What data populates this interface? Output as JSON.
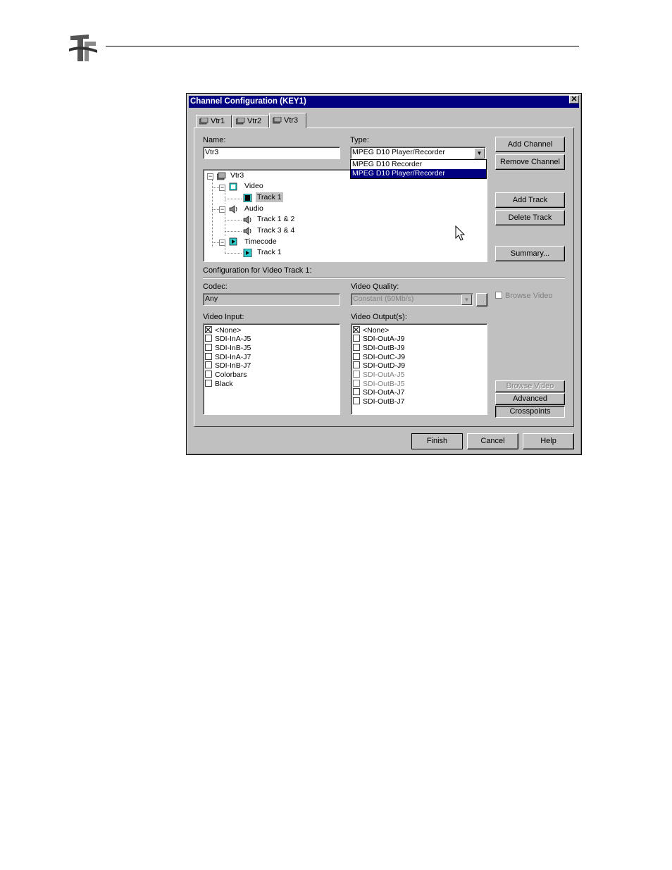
{
  "dialog": {
    "title": "Channel Configuration (KEY1)",
    "close_glyph": "✕"
  },
  "tabs": [
    {
      "label": "Vtr1",
      "icon": "vtr-icon"
    },
    {
      "label": "Vtr2",
      "icon": "vtr-icon"
    },
    {
      "label": "Vtr3",
      "icon": "vtr-icon",
      "active": true
    }
  ],
  "name": {
    "label": "Name:",
    "value": "Vtr3"
  },
  "type": {
    "label": "Type:",
    "value": "MPEG D10 Player/Recorder",
    "options": [
      "MPEG D10 Recorder",
      "MPEG D10 Player/Recorder"
    ],
    "selected_option": "MPEG D10 Player/Recorder"
  },
  "tree": {
    "root": "Vtr3",
    "video": "Video",
    "video_track": "Track 1",
    "audio": "Audio",
    "audio_tracks": [
      "Track 1 & 2",
      "Track 3 & 4"
    ],
    "timecode": "Timecode",
    "timecode_track": "Track 1"
  },
  "side_buttons": {
    "add_channel": "Add Channel",
    "remove_channel": "Remove Channel",
    "add_track": "Add Track",
    "delete_track": "Delete Track",
    "summary": "Summary..."
  },
  "config_heading": "Configuration for Video Track 1:",
  "codec": {
    "label": "Codec:",
    "value": "Any"
  },
  "video_quality": {
    "label": "Video Quality:",
    "value": "Constant (50Mb/s)",
    "ellipsis": "..."
  },
  "browse_video_checkbox": "Browse Video",
  "video_input": {
    "label": "Video Input:",
    "items": [
      {
        "label": "<None>",
        "checked": true
      },
      {
        "label": "SDI-InA-J5",
        "checked": false
      },
      {
        "label": "SDI-InB-J5",
        "checked": false
      },
      {
        "label": "SDI-InA-J7",
        "checked": false
      },
      {
        "label": "SDI-InB-J7",
        "checked": false
      },
      {
        "label": "Colorbars",
        "checked": false
      },
      {
        "label": "Black",
        "checked": false
      }
    ]
  },
  "video_outputs": {
    "label": "Video Output(s):",
    "items": [
      {
        "label": "<None>",
        "checked": true,
        "enabled": true
      },
      {
        "label": "SDI-OutA-J9",
        "checked": false,
        "enabled": true
      },
      {
        "label": "SDI-OutB-J9",
        "checked": false,
        "enabled": true
      },
      {
        "label": "SDI-OutC-J9",
        "checked": false,
        "enabled": true
      },
      {
        "label": "SDI-OutD-J9",
        "checked": false,
        "enabled": true
      },
      {
        "label": "SDI-OutA-J5",
        "checked": false,
        "enabled": false
      },
      {
        "label": "SDI-OutB-J5",
        "checked": false,
        "enabled": false
      },
      {
        "label": "SDI-OutA-J7",
        "checked": false,
        "enabled": true
      },
      {
        "label": "SDI-OutB-J7",
        "checked": false,
        "enabled": true
      }
    ]
  },
  "lower_buttons": {
    "browse_video": "Browse Video",
    "advanced": "Advanced",
    "crosspoints": "Crosspoints"
  },
  "footer_buttons": {
    "finish": "Finish",
    "cancel": "Cancel",
    "help": "Help"
  },
  "colors": {
    "title_bar": "#000080",
    "dialog_face": "#c0c0c0",
    "selection": "#000080"
  }
}
